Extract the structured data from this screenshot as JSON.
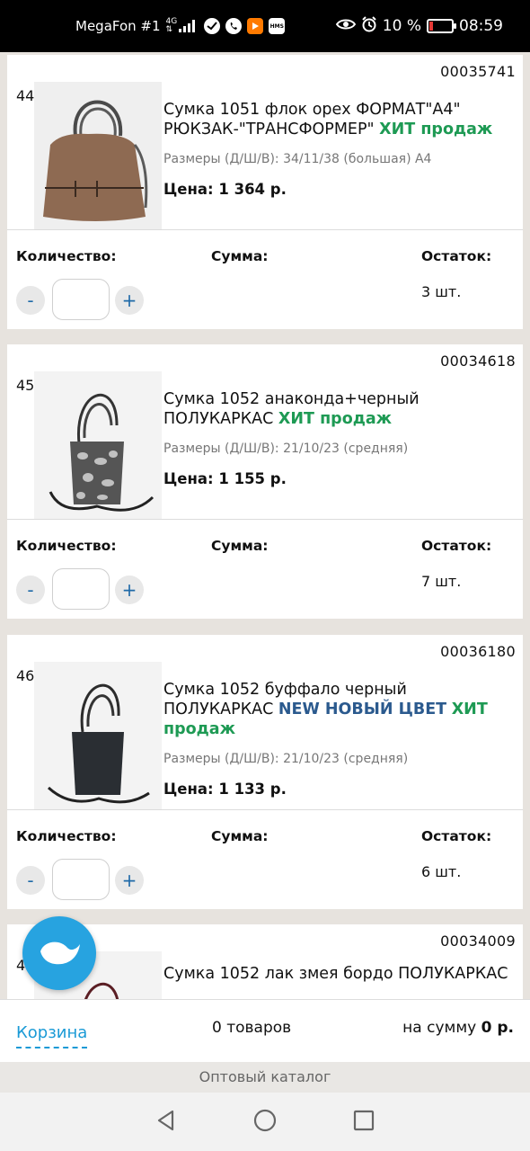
{
  "status_bar": {
    "carrier": "MegaFon #1",
    "network": "4G",
    "battery": "10 %",
    "time": "08:59",
    "icons": [
      "signal-icon",
      "sberbank-icon",
      "viber-icon",
      "play-icon",
      "hms-icon",
      "eye-icon",
      "alarm-icon",
      "battery-icon"
    ]
  },
  "labels": {
    "quantity": "Количество:",
    "sum": "Сумма:",
    "stock": "Остаток:",
    "minus": "-",
    "plus": "+"
  },
  "products": [
    {
      "number": "44",
      "code": "00035741",
      "title": "Сумка 1051 флок орех ФОРМАТ\"А4\" РЮКЗАК-\"ТРАНСФОРМЕР\"",
      "badge_new": "",
      "badge_hit": "ХИТ продаж",
      "sizes": "Размеры (Д/Ш/В): 34/11/38 (большая) А4",
      "price": "Цена: 1 364 р.",
      "stock": "3 шт.",
      "quantity": ""
    },
    {
      "number": "45",
      "code": "00034618",
      "title": "Сумка 1052 анаконда+черный ПОЛУКАРКАС",
      "badge_new": "",
      "badge_hit": "ХИТ продаж",
      "sizes": "Размеры (Д/Ш/В): 21/10/23 (средняя)",
      "price": "Цена: 1 155 р.",
      "stock": "7 шт.",
      "quantity": ""
    },
    {
      "number": "46",
      "code": "00036180",
      "title": "Сумка 1052 буффало черный ПОЛУКАРКАС",
      "badge_new": "NEW НОВЫЙ ЦВЕТ",
      "badge_hit": "ХИТ продаж",
      "sizes": "Размеры (Д/Ш/В): 21/10/23 (средняя)",
      "price": "Цена: 1 133 р.",
      "stock": "6 шт.",
      "quantity": ""
    },
    {
      "number": "47",
      "code": "00034009",
      "title": "Сумка 1052 лак змея бордо ПОЛУКАРКАС"
    }
  ],
  "cart": {
    "link": "Корзина",
    "count": "0 товаров",
    "sum_label": "на сумму",
    "sum_value": "0 р."
  },
  "catalog_label": "Оптовый каталог",
  "nav": [
    "back-icon",
    "home-icon",
    "recents-icon"
  ],
  "colors": {
    "hit": "#1e9a54",
    "new": "#2b5a8e",
    "accent": "#1a9ad6",
    "fab": "#27a3e0"
  }
}
